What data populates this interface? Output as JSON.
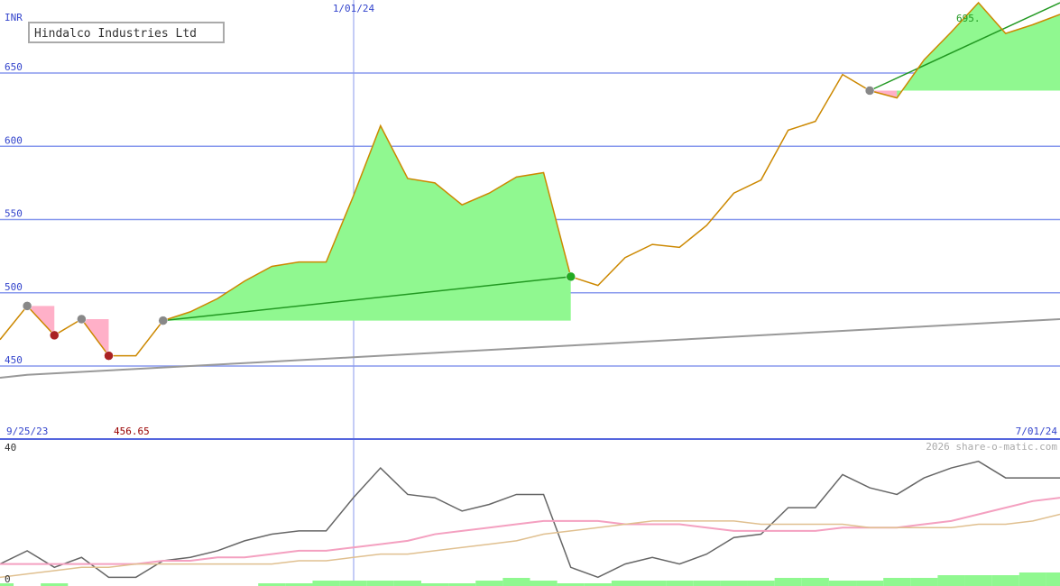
{
  "title": "Hindalco Industries Ltd",
  "watermark": "2026 share-o-matic.com",
  "colors": {
    "price_line": "#cc8800",
    "gain_fill": "#90f890",
    "loss_fill": "#ffb0c8",
    "trend_line": "#229922",
    "ma_long": "#999999",
    "grid": "#8899ee",
    "axis_text": "#3344cc",
    "osc_main": "#666666",
    "osc_pink": "#f4a0c0",
    "osc_tan": "#e0c090",
    "volume": "#90f890",
    "low_label": "#990000",
    "high_label": "#229922",
    "marker_grey": "#888888",
    "marker_red": "#aa2222",
    "marker_green": "#22aa22"
  },
  "chart_data": [
    {
      "type": "line",
      "title": "Hindalco Industries Ltd",
      "ylabel": "INR",
      "ylim": [
        400,
        700
      ],
      "y_ticks": [
        "450",
        "500",
        "550",
        "600",
        "650"
      ],
      "x_start_label": "9/25/23",
      "x_mid_label": "1/01/24",
      "x_end_label": "7/01/24",
      "annotations": {
        "low": "456.65",
        "high": "695."
      },
      "grid": true,
      "price": [
        468,
        491,
        471,
        482,
        457,
        457,
        481,
        487,
        496,
        508,
        518,
        521,
        521,
        566,
        614,
        578,
        575,
        560,
        568,
        579,
        582,
        511,
        505,
        524,
        533,
        531,
        546,
        568,
        577,
        611,
        617,
        649,
        638,
        633,
        659,
        678,
        698,
        677,
        683,
        690
      ],
      "ma_long": [
        442,
        444,
        445,
        446,
        447,
        448,
        449,
        450,
        451,
        452,
        453,
        454,
        455,
        456,
        457,
        458,
        459,
        460,
        461,
        462,
        463,
        464,
        465,
        466,
        467,
        468,
        469,
        470,
        471,
        472,
        473,
        474,
        475,
        476,
        477,
        478,
        479,
        480,
        481,
        482
      ],
      "trend_segments": [
        {
          "from": 6,
          "to": 21,
          "start": 481,
          "end": 511
        },
        {
          "from": 32,
          "to": 39,
          "start": 638,
          "end": 698
        }
      ],
      "loss_boxes": [
        {
          "from": 1,
          "to": 2,
          "high": 491,
          "low": 471
        },
        {
          "from": 3,
          "to": 4,
          "high": 482,
          "low": 457
        },
        {
          "from": 32,
          "to": 33,
          "high": 638,
          "low": 633
        }
      ]
    },
    {
      "type": "line",
      "ylabel": "",
      "ylim": [
        0,
        40
      ],
      "y_ticks": [
        "0",
        "40"
      ],
      "series": [
        {
          "values": [
            5,
            9,
            4,
            7,
            1,
            1,
            6,
            7,
            9,
            12,
            14,
            15,
            15,
            25,
            34,
            26,
            25,
            21,
            23,
            26,
            26,
            4,
            1,
            5,
            7,
            5,
            8,
            13,
            14,
            22,
            22,
            32,
            28,
            26,
            31,
            34,
            36,
            31,
            31,
            31
          ]
        },
        {
          "values": [
            5,
            5,
            5,
            5,
            5,
            5,
            6,
            6,
            7,
            7,
            8,
            9,
            9,
            10,
            11,
            12,
            14,
            15,
            16,
            17,
            18,
            18,
            18,
            17,
            17,
            17,
            16,
            15,
            15,
            15,
            15,
            16,
            16,
            16,
            17,
            18,
            20,
            22,
            24,
            25
          ]
        },
        {
          "values": [
            1,
            2,
            3,
            4,
            4,
            5,
            5,
            5,
            5,
            5,
            5,
            6,
            6,
            7,
            8,
            8,
            9,
            10,
            11,
            12,
            14,
            15,
            16,
            17,
            18,
            18,
            18,
            18,
            17,
            17,
            17,
            17,
            16,
            16,
            16,
            16,
            17,
            17,
            18,
            20
          ]
        }
      ],
      "volume": [
        1,
        0,
        1,
        0,
        0,
        0,
        0,
        0,
        0,
        0,
        1,
        1,
        2,
        2,
        2,
        2,
        1,
        1,
        2,
        3,
        2,
        1,
        1,
        2,
        2,
        2,
        2,
        2,
        2,
        3,
        3,
        2,
        2,
        3,
        3,
        4,
        4,
        4,
        5,
        5
      ]
    }
  ]
}
